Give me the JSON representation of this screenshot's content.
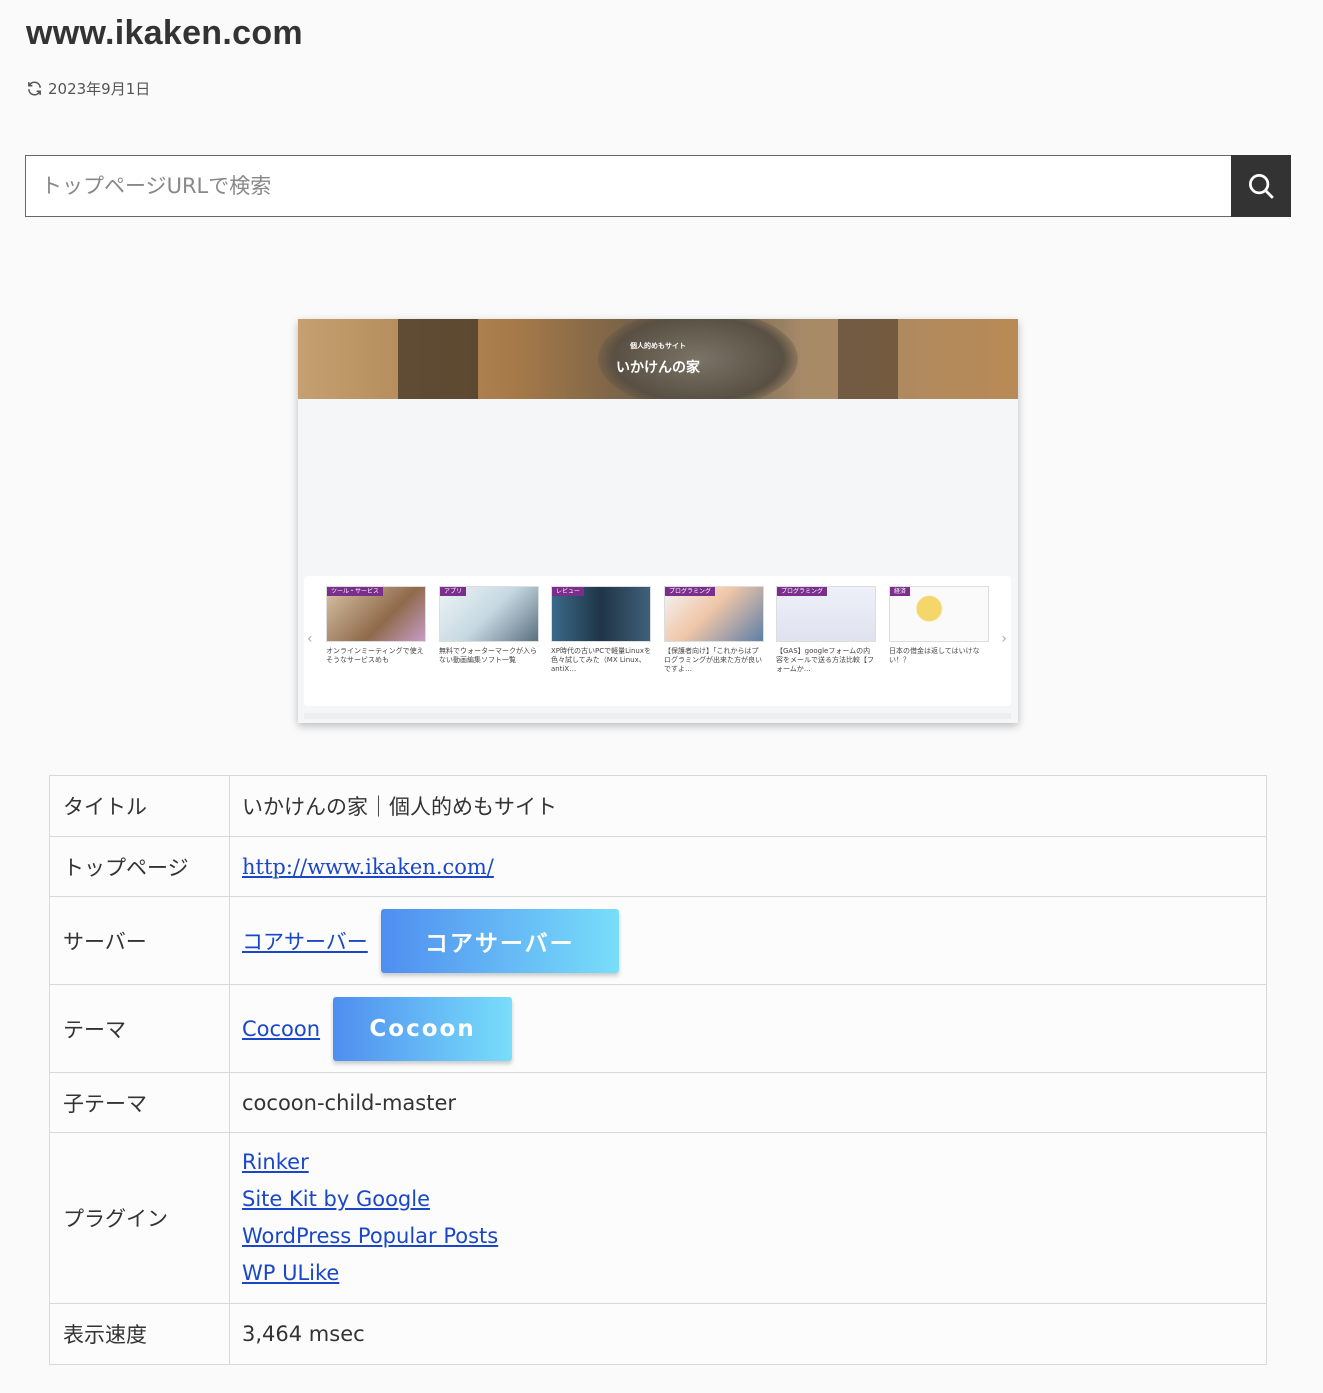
{
  "header": {
    "title": "www.ikaken.com",
    "date": "2023年9月1日"
  },
  "search": {
    "placeholder": "トップページURLで検索"
  },
  "screenshot": {
    "site_subtitle": "個人的めもサイト",
    "site_name": "いかけんの家",
    "cards": [
      {
        "category": "ツール・サービス",
        "title": "オンラインミーティングで使えそうなサービスめも"
      },
      {
        "category": "アプリ",
        "title": "無料でウォーターマークが入らない動画編集ソフト一覧"
      },
      {
        "category": "レビュー",
        "title": "XP時代の古いPCで軽量Linuxを色々試してみた（MX Linux、antiX…"
      },
      {
        "category": "プログラミング",
        "title": "【保護者向け】「これからはプログラミングが出来た方が良いですよ…"
      },
      {
        "category": "プログラミング",
        "title": "【GAS】googleフォームの内容をメールで送る方法比較【フォームか…"
      },
      {
        "category": "経済",
        "title": "日本の借金は返してはいけない！？"
      }
    ]
  },
  "table": {
    "title_label": "タイトル",
    "title_value": "いかけんの家｜個人的めもサイト",
    "top_label": "トップページ",
    "top_value": "http://www.ikaken.com/",
    "server_label": "サーバー",
    "server_link": "コアサーバー",
    "server_button": "コアサーバー",
    "theme_label": "テーマ",
    "theme_link": "Cocoon",
    "theme_button": "Cocoon",
    "child_label": "子テーマ",
    "child_value": "cocoon-child-master",
    "plugins_label": "プラグイン",
    "plugins": [
      "Rinker",
      "Site Kit by Google",
      "WordPress Popular Posts",
      "WP ULike"
    ],
    "speed_label": "表示速度",
    "speed_value": "3,464 msec"
  },
  "colors": {
    "button_gradient_start": "#4f8ef0",
    "button_gradient_end": "#78defa",
    "link": "#1a47c8",
    "search_button": "#333333"
  }
}
